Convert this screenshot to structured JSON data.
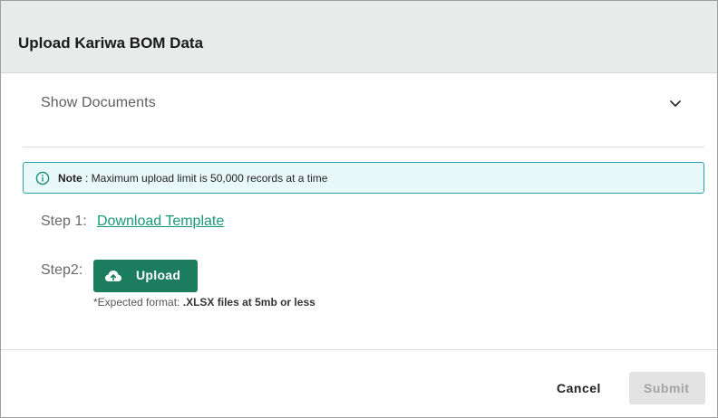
{
  "dialog": {
    "title": "Upload Kariwa BOM Data"
  },
  "documents": {
    "toggle_label": "Show Documents",
    "toggle_icon": "chevron-down-icon"
  },
  "note": {
    "icon": "info-icon",
    "label": "Note",
    "text": ": Maximum upload limit is 50,000 records at a time",
    "border_color": "#2aa2a8",
    "background_color": "#e9f9f9"
  },
  "steps": {
    "step1_label": "Step 1:",
    "download_link": "Download Template",
    "step2_label": "Step2:",
    "upload_button": "Upload",
    "upload_icon": "cloud-upload-icon",
    "format_prefix": "*Expected format:",
    "format_value": ".XLSX files at 5mb or less"
  },
  "footer": {
    "cancel_label": "Cancel",
    "submit_label": "Submit"
  },
  "colors": {
    "primary": "#1b7d5e",
    "link": "#199a77",
    "header_background": "#e9ebea",
    "disabled_button": "#e3e3e3"
  }
}
